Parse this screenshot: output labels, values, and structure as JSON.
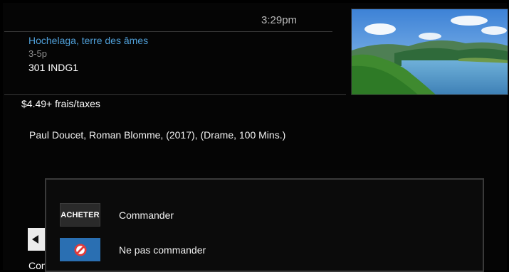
{
  "header": {
    "clock": "3:29pm"
  },
  "program": {
    "title": "Hochelaga, terre des âmes",
    "time": "3-5p",
    "channel": "301 INDG1",
    "price": "$4.49+ frais/taxes",
    "credits": "Paul Doucet, Roman Blomme, (2017), (Drame, 100 Mins.)"
  },
  "preview": {
    "scene": "lake-mountains-landscape"
  },
  "footer": {
    "truncated_text": "Con"
  },
  "dialog": {
    "options": [
      {
        "badge": "ACHETER",
        "label": "Commander"
      },
      {
        "badge_icon": "no-entry-icon",
        "label": "Ne pas commander"
      }
    ]
  },
  "colors": {
    "title": "#4f9fd8",
    "selected": "#2a6fb2",
    "no_icon": "#e23b3b"
  }
}
